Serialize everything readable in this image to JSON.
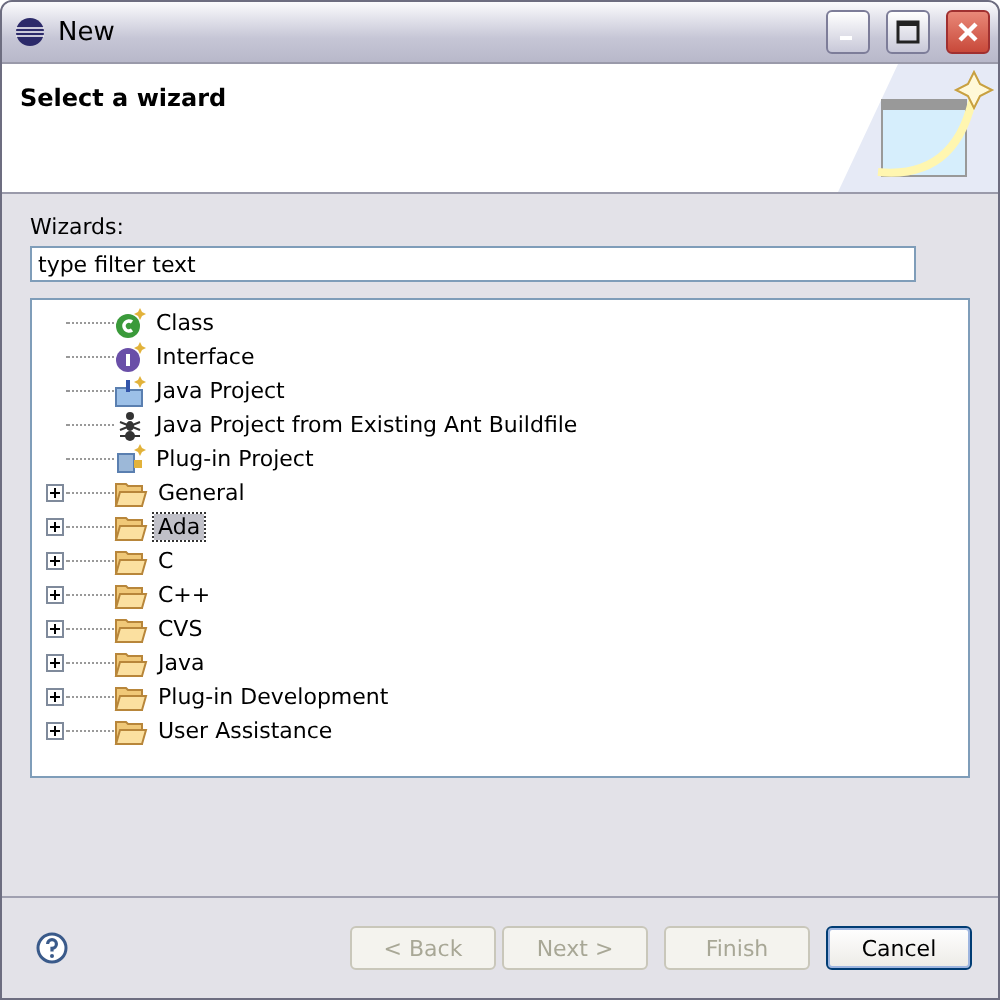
{
  "window": {
    "title": "New"
  },
  "header": {
    "title": "Select a wizard"
  },
  "filter": {
    "label": "Wizards:",
    "placeholder": "type filter text"
  },
  "tree": [
    {
      "label": "Class",
      "kind": "class",
      "selected": false
    },
    {
      "label": "Interface",
      "kind": "interface",
      "selected": false
    },
    {
      "label": "Java Project",
      "kind": "java-project",
      "selected": false
    },
    {
      "label": "Java Project from Existing Ant Buildfile",
      "kind": "ant",
      "selected": false
    },
    {
      "label": "Plug-in Project",
      "kind": "plugin",
      "selected": false
    },
    {
      "label": "General",
      "kind": "folder",
      "expanded": false,
      "selected": false
    },
    {
      "label": "Ada",
      "kind": "folder",
      "expanded": false,
      "selected": true
    },
    {
      "label": "C",
      "kind": "folder",
      "expanded": false,
      "selected": false
    },
    {
      "label": "C++",
      "kind": "folder",
      "expanded": false,
      "selected": false
    },
    {
      "label": "CVS",
      "kind": "folder",
      "expanded": false,
      "selected": false
    },
    {
      "label": "Java",
      "kind": "folder",
      "expanded": false,
      "selected": false
    },
    {
      "label": "Plug-in Development",
      "kind": "folder",
      "expanded": false,
      "selected": false
    },
    {
      "label": "User Assistance",
      "kind": "folder",
      "expanded": false,
      "selected": false
    }
  ],
  "buttons": [
    {
      "label": "< Back",
      "disabled": true,
      "default": false
    },
    {
      "label": "Next >",
      "disabled": true,
      "default": false
    },
    {
      "label": "Finish",
      "disabled": true,
      "default": false
    },
    {
      "label": "Cancel",
      "disabled": false,
      "default": true
    }
  ]
}
